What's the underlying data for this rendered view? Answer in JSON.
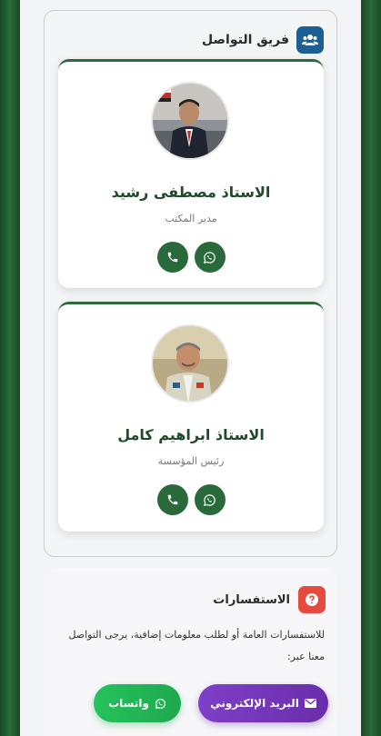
{
  "team": {
    "title": "فريق التواصل",
    "icon": "users-icon",
    "members": [
      {
        "name": "الاستاذ مصطفى رشيد",
        "role": "مدير المكتب"
      },
      {
        "name": "الاستاذ ابراهيم كامل",
        "role": "رئيس المؤسسة"
      }
    ]
  },
  "inquiries": {
    "title": "الاستفسارات",
    "icon": "question-icon",
    "text": "للاستفسارات العامة أو لطلب معلومات إضافية، يرجى التواصل معنا عبر:",
    "email_label": "البريد الإلكتروني",
    "whatsapp_label": "واتساب"
  },
  "colors": {
    "primary_green": "#2a6a3a",
    "email_purple": "#7e3fc8",
    "whatsapp_green": "#25c25c",
    "team_icon_bg": "#1d5f95",
    "inquiry_icon_bg": "#e64a3f"
  }
}
